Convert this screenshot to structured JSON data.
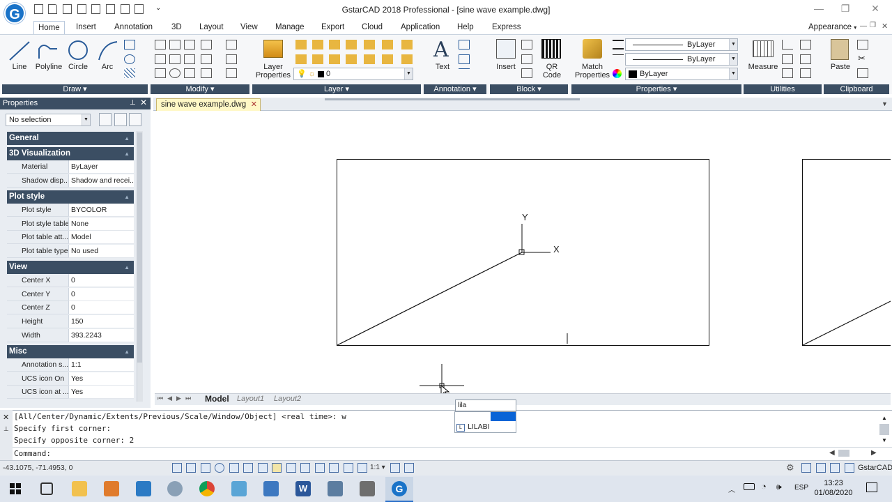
{
  "window": {
    "title": "GstarCAD 2018 Professional - [sine wave example.dwg]",
    "logo_letter": "G"
  },
  "ribbon": {
    "tabs": [
      "Home",
      "Insert",
      "Annotation",
      "3D",
      "Layout",
      "View",
      "Manage",
      "Export",
      "Cloud",
      "Application",
      "Help",
      "Express"
    ],
    "active_tab": "Home",
    "appearance_label": "Appearance",
    "draw": {
      "line": "Line",
      "polyline": "Polyline",
      "circle": "Circle",
      "arc": "Arc"
    },
    "layer": {
      "layer_properties": "Layer\nProperties",
      "current_layer": "0"
    },
    "annotation": {
      "text": "Text"
    },
    "block": {
      "insert": "Insert",
      "qr_code": "QR\nCode"
    },
    "properties": {
      "match_properties": "Match\nProperties",
      "linetype": "ByLayer",
      "lineweight": "ByLayer",
      "color": "ByLayer"
    },
    "utilities": {
      "measure": "Measure"
    },
    "clipboard": {
      "paste": "Paste"
    },
    "panels": [
      "Draw",
      "Modify",
      "Layer",
      "Annotation",
      "Block",
      "Properties",
      "Utilities",
      "Clipboard"
    ]
  },
  "properties_palette": {
    "title": "Properties",
    "selection": "No selection",
    "sections": [
      {
        "name": "General",
        "rows": []
      },
      {
        "name": "3D Visualization",
        "rows": [
          {
            "key": "Material",
            "value": "ByLayer"
          },
          {
            "key": "Shadow disp...",
            "value": "Shadow and recei..."
          }
        ]
      },
      {
        "name": "Plot style",
        "rows": [
          {
            "key": "Plot style",
            "value": "BYCOLOR"
          },
          {
            "key": "Plot style table",
            "value": "None"
          },
          {
            "key": "Plot table att...",
            "value": "Model"
          },
          {
            "key": "Plot table type",
            "value": "No used"
          }
        ]
      },
      {
        "name": "View",
        "rows": [
          {
            "key": "Center X",
            "value": "0"
          },
          {
            "key": "Center Y",
            "value": "0"
          },
          {
            "key": "Center Z",
            "value": "0"
          },
          {
            "key": "Height",
            "value": "150"
          },
          {
            "key": "Width",
            "value": "393.2243"
          }
        ]
      },
      {
        "name": "Misc",
        "rows": [
          {
            "key": "Annotation s...",
            "value": "1:1"
          },
          {
            "key": "UCS icon On",
            "value": "Yes"
          },
          {
            "key": "UCS icon at ...",
            "value": "Yes"
          }
        ]
      }
    ]
  },
  "document": {
    "tab_name": "sine wave example.dwg",
    "layout_tabs": [
      "Model",
      "Layout1",
      "Layout2"
    ],
    "active_layout": "Model",
    "ucs_x": "X",
    "ucs_y": "Y"
  },
  "command": {
    "history": [
      "[All/Center/Dynamic/Extents/Previous/Scale/Window/Object] <real time>: w",
      "Specify first corner:",
      "Specify opposite corner: 2"
    ],
    "prompt": "Command:",
    "autocomplete_input": "lila",
    "autocomplete_item": "LILABI"
  },
  "status": {
    "coordinates": "-43.1075, -71.4953, 0",
    "scale": "1:1",
    "app_name": "GstarCAD"
  },
  "taskbar": {
    "language": "ESP",
    "time": "13:23",
    "date": "01/08/2020"
  },
  "colors": {
    "accent": "#1a73c8",
    "panel_dark": "#3b4e63",
    "doc_tab": "#fff8c6",
    "selection": "#0a64d6"
  }
}
